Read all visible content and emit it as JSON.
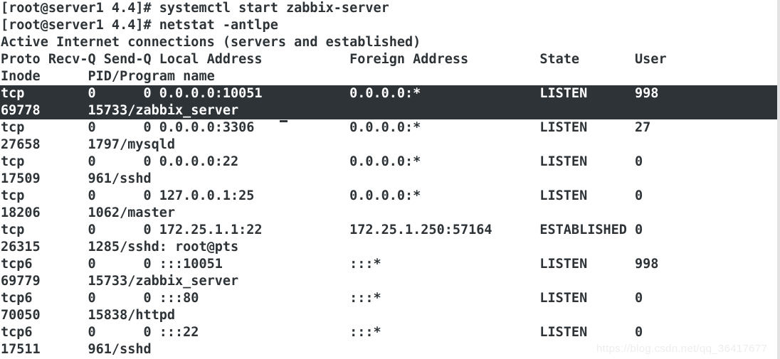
{
  "terminal": {
    "prompt": "[root@server1 4.4]#",
    "commands": [
      "systemctl start zabbix-server",
      "netstat -antlpe"
    ],
    "banner": "Active Internet connections (servers and established)",
    "columns": {
      "proto": "Proto",
      "recv_q": "Recv-Q",
      "send_q": "Send-Q",
      "local_address": "Local Address",
      "foreign_address": "Foreign Address",
      "state": "State",
      "user": "User",
      "inode": "Inode",
      "pid_program": "PID/Program name"
    },
    "header_line_1": "Proto Recv-Q Send-Q Local Address           Foreign Address         State       User",
    "header_line_2": "Inode      PID/Program name",
    "connections": [
      {
        "proto": "tcp",
        "recv_q": "0",
        "send_q": "0",
        "local_address": "0.0.0.0:10051",
        "foreign_address": "0.0.0.0:*",
        "state": "LISTEN",
        "user": "998",
        "inode": "69778",
        "pid_program": "15733/zabbix_server",
        "selected": true,
        "line_1": "tcp        0      0 0.0.0.0:10051           0.0.0.0:*               LISTEN      998",
        "line_2": "69778      15733/zabbix_server"
      },
      {
        "proto": "tcp",
        "recv_q": "0",
        "send_q": "0",
        "local_address": "0.0.0.0:3306",
        "foreign_address": "0.0.0.0:*",
        "state": "LISTEN",
        "user": "27",
        "inode": "27658",
        "pid_program": "1797/mysqld",
        "selected": false,
        "line_1": "tcp        0      0 0.0.0.0:3306            0.0.0.0:*               LISTEN      27",
        "line_2": "27658      1797/mysqld"
      },
      {
        "proto": "tcp",
        "recv_q": "0",
        "send_q": "0",
        "local_address": "0.0.0.0:22",
        "foreign_address": "0.0.0.0:*",
        "state": "LISTEN",
        "user": "0",
        "inode": "17509",
        "pid_program": "961/sshd",
        "selected": false,
        "line_1": "tcp        0      0 0.0.0.0:22              0.0.0.0:*               LISTEN      0",
        "line_2": "17509      961/sshd"
      },
      {
        "proto": "tcp",
        "recv_q": "0",
        "send_q": "0",
        "local_address": "127.0.0.1:25",
        "foreign_address": "0.0.0.0:*",
        "state": "LISTEN",
        "user": "0",
        "inode": "18206",
        "pid_program": "1062/master",
        "selected": false,
        "line_1": "tcp        0      0 127.0.0.1:25            0.0.0.0:*               LISTEN      0",
        "line_2": "18206      1062/master"
      },
      {
        "proto": "tcp",
        "recv_q": "0",
        "send_q": "0",
        "local_address": "172.25.1.1:22",
        "foreign_address": "172.25.1.250:57164",
        "state": "ESTABLISHED",
        "user": "0",
        "inode": "26315",
        "pid_program": "1285/sshd: root@pts",
        "selected": false,
        "line_1": "tcp        0      0 172.25.1.1:22           172.25.1.250:57164      ESTABLISHED 0",
        "line_2": "26315      1285/sshd: root@pts"
      },
      {
        "proto": "tcp6",
        "recv_q": "0",
        "send_q": "0",
        "local_address": ":::10051",
        "foreign_address": ":::*",
        "state": "LISTEN",
        "user": "998",
        "inode": "69779",
        "pid_program": "15733/zabbix_server",
        "selected": false,
        "line_1": "tcp6       0      0 :::10051                :::*                    LISTEN      998",
        "line_2": "69779      15733/zabbix_server"
      },
      {
        "proto": "tcp6",
        "recv_q": "0",
        "send_q": "0",
        "local_address": ":::80",
        "foreign_address": ":::*",
        "state": "LISTEN",
        "user": "0",
        "inode": "70050",
        "pid_program": "15838/httpd",
        "selected": false,
        "line_1": "tcp6       0      0 :::80                   :::*                    LISTEN      0",
        "line_2": "70050      15838/httpd"
      },
      {
        "proto": "tcp6",
        "recv_q": "0",
        "send_q": "0",
        "local_address": ":::22",
        "foreign_address": ":::*",
        "state": "LISTEN",
        "user": "0",
        "inode": "17511",
        "pid_program": "961/sshd",
        "selected": false,
        "line_1": "tcp6       0      0 :::22                   :::*                    LISTEN      0",
        "line_2": "17511      961/sshd"
      }
    ],
    "lines": [
      "[root@server1 4.4]# systemctl start zabbix-server",
      "[root@server1 4.4]# netstat -antlpe",
      "Active Internet connections (servers and established)",
      "Proto Recv-Q Send-Q Local Address           Foreign Address         State       User",
      "Inode      PID/Program name",
      "tcp        0      0 0.0.0.0:10051           0.0.0.0:*               LISTEN      998",
      "69778      15733/zabbix_server",
      "tcp        0      0 0.0.0.0:3306            0.0.0.0:*               LISTEN      27",
      "27658      1797/mysqld",
      "tcp        0      0 0.0.0.0:22              0.0.0.0:*               LISTEN      0",
      "17509      961/sshd",
      "tcp        0      0 127.0.0.1:25            0.0.0.0:*               LISTEN      0",
      "18206      1062/master",
      "tcp        0      0 172.25.1.1:22           172.25.1.250:57164      ESTABLISHED 0",
      "26315      1285/sshd: root@pts",
      "tcp6       0      0 :::10051                :::*                    LISTEN      998",
      "69779      15733/zabbix_server",
      "tcp6       0      0 :::80                   :::*                    LISTEN      0",
      "70050      15838/httpd",
      "tcp6       0      0 :::22                   :::*                    LISTEN      0",
      "17511      961/sshd"
    ],
    "colors": {
      "background": "#ffffff",
      "foreground": "#2d3337",
      "selection_background": "#2d3337",
      "selection_foreground": "#ffffff",
      "scrollbar": "#e3e3e3",
      "watermark": "#eeeeee"
    }
  },
  "watermark": {
    "text": "https://blog.csdn.net/qq_36417677"
  }
}
